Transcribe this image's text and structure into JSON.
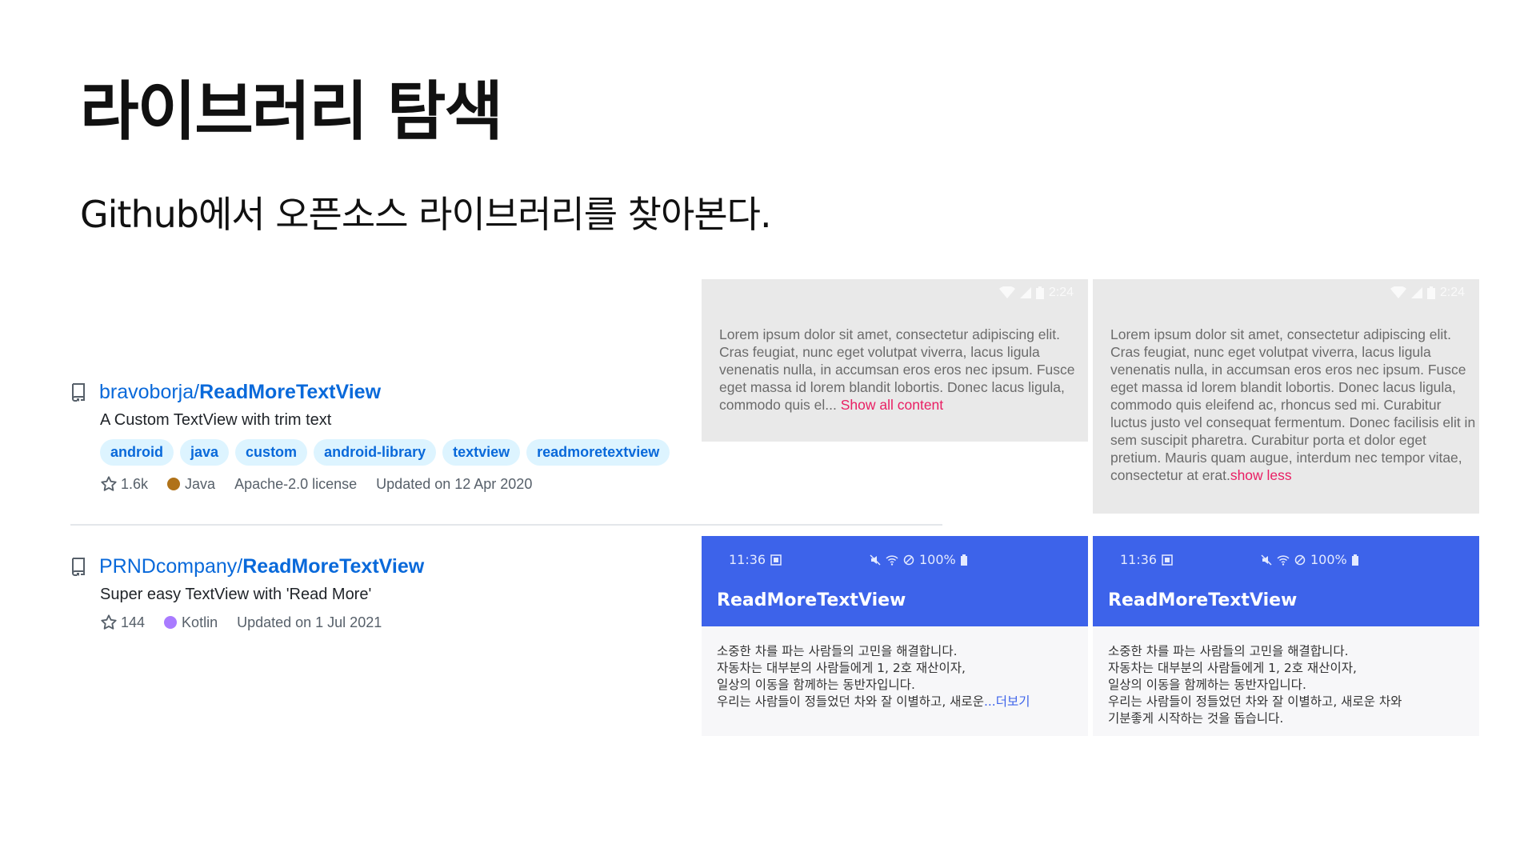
{
  "slide": {
    "title": "라이브러리 탐색",
    "subtitle": "Github에서 오픈소스 라이브러리를 찾아본다."
  },
  "repos": [
    {
      "owner": "bravoborja",
      "slash": "/",
      "name": "ReadMoreTextView",
      "description": "A Custom TextView with trim text",
      "topics": [
        "android",
        "java",
        "custom",
        "android-library",
        "textview",
        "readmoretextview"
      ],
      "stars": "1.6k",
      "language": "Java",
      "language_color": "#b07219",
      "license": "Apache-2.0 license",
      "updated": "Updated on 12 Apr 2020"
    },
    {
      "owner": "PRNDcompany",
      "slash": "/",
      "name": "ReadMoreTextView",
      "description": "Super easy TextView with 'Read More'",
      "stars": "144",
      "language": "Kotlin",
      "language_color": "#a97bff",
      "updated": "Updated on 1 Jul 2021"
    }
  ],
  "screens": {
    "gray_collapsed": {
      "time": "2:24",
      "text": "Lorem ipsum dolor sit amet, consectetur adipiscing elit. Cras feugiat, nunc eget volutpat viverra, lacus ligula venenatis nulla, in accumsan eros eros nec ipsum. Fusce eget massa id lorem blandit lobortis. Donec lacus ligula, commodo quis el...",
      "link": " Show all content"
    },
    "gray_expanded": {
      "time": "2:24",
      "text": "Lorem ipsum dolor sit amet, consectetur adipiscing elit. Cras feugiat, nunc eget volutpat viverra, lacus ligula venenatis nulla, in accumsan eros eros nec ipsum. Fusce eget massa id lorem blandit lobortis. Donec lacus ligula, commodo quis eleifend ac, rhoncus sed mi. Curabitur luctus justo vel consequat fermentum. Donec facilisis elit in sem suscipit pharetra. Curabitur porta et dolor eget pretium. Mauris quam augue, interdum nec tempor vitae, consectetur at erat.",
      "link": "show less"
    },
    "blue_collapsed": {
      "time": "11:36",
      "battery": "100%",
      "app_title": "ReadMoreTextView",
      "lines": [
        "소중한 차를 파는 사람들의 고민을 해결합니다.",
        "자동차는 대부분의 사람들에게 1, 2호 재산이자,",
        "일상의 이동을 함께하는 동반자입니다."
      ],
      "last_line": "우리는 사람들이 정들었던 차와 잘 이별하고, 새로운",
      "more": "...더보기"
    },
    "blue_expanded": {
      "time": "11:36",
      "battery": "100%",
      "app_title": "ReadMoreTextView",
      "lines": [
        "소중한 차를 파는 사람들의 고민을 해결합니다.",
        "자동차는 대부분의 사람들에게 1, 2호 재산이자,",
        "일상의 이동을 함께하는 동반자입니다.",
        "우리는 사람들이 정들었던 차와 잘 이별하고, 새로운 차와",
        "기분좋게 시작하는 것을 돕습니다."
      ]
    }
  },
  "icons": {
    "repo": "repo-icon",
    "star": "star-icon"
  }
}
